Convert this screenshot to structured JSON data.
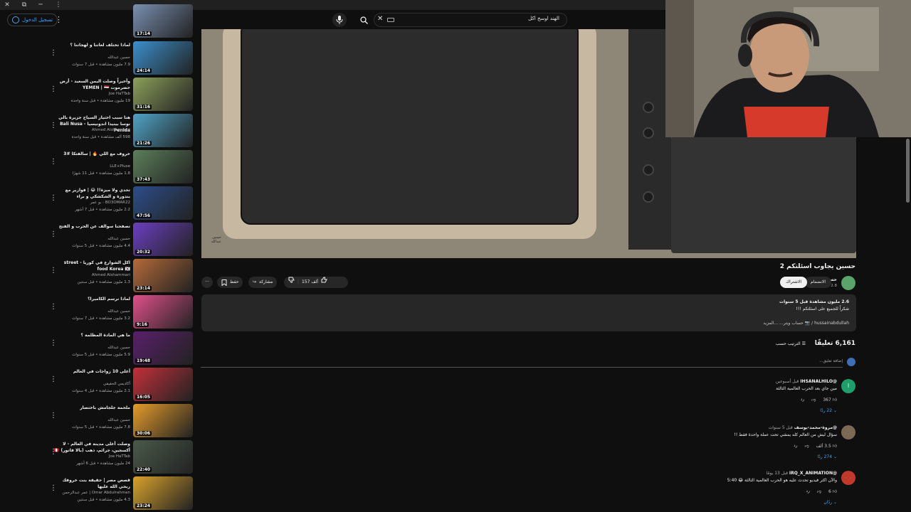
{
  "window": {
    "close": "✕",
    "restore": "⧉",
    "minimize": "─",
    "menu": "⋮"
  },
  "header": {
    "signin_label": "تسجيل الدخول",
    "search_value": "الهند اوسخ اكل"
  },
  "sidebar": {
    "items": [
      {
        "title": "",
        "channel": "",
        "meta": "",
        "duration": "17:14",
        "color": "#7a8fb0"
      },
      {
        "title": "لماذا تختلف لغاتنا و لهجاتنا ؟",
        "channel": "حسين عبدالله",
        "meta": "7.9 مليون مشاهدة • قبل 7 سنوات",
        "duration": "24:14",
        "color": "#3b8fcc"
      },
      {
        "title": "وأخيراً وصلت اليمن السعيد - أرض حضرموت YEMEN | 🇾🇪",
        "channel": "Joe HaTTab",
        "meta": "19 مليون مشاهدة • قبل سنة واحدة",
        "duration": "31:16",
        "color": "#8ca05a"
      },
      {
        "title": "هنا سبب اختيار السياح جزيرة بالي نوسا بينيدا اندونيسيا - Bali Nusa Penida",
        "channel": "Ahmed Alshammari",
        "meta": "598 ألف مشاهدة • قبل سنة واحدة",
        "duration": "21:26",
        "color": "#4fa3c7"
      },
      {
        "title": "خروف مع اللي 🔥 | سالفتكا #3",
        "channel": "LLE+Pluse",
        "meta": "1.8 مليون مشاهدة • قبل 11 شهرًا",
        "duration": "37:43",
        "color": "#5c7f5a"
      },
      {
        "title": "تحدي ولا ميزة!! 😂 | فوازير مع بندورة و الشكشكي و براء",
        "channel": "BO3OMAR22 - بو عمر",
        "meta": "2.2 مليون مشاهدة • قبل 7 أشهر",
        "duration": "47:56",
        "color": "#2d4d8a"
      },
      {
        "title": "تصفحنا سوالف عن الحرب و الفتح",
        "channel": "حسين عبدالله",
        "meta": "4.4 مليون مشاهدة • قبل 5 سنوات",
        "duration": "20:32",
        "color": "#6b3fc2"
      },
      {
        "title": "اكل الشوارع في كوريا - street food Korea 🇰🇷",
        "channel": "Ahmed Alshammari",
        "meta": "1.3 مليون مشاهدة • قبل سنتين",
        "duration": "23:14",
        "color": "#b46a3a"
      },
      {
        "title": "لماذا نرسم الكاميرا؟",
        "channel": "حسين عبدالله",
        "meta": "3.2 مليون مشاهدة • قبل 7 سنوات",
        "duration": "9:16",
        "color": "#e0508a"
      },
      {
        "title": "ما هي المادة المظلمة ؟",
        "channel": "حسين عبدالله",
        "meta": "5.9 مليون مشاهدة • قبل 5 سنوات",
        "duration": "19:48",
        "color": "#5a1f6b"
      },
      {
        "title": "أغلى 10 زواجات في العالم",
        "channel": "أكاديمي الحقيقي",
        "meta": "2.1 مليون مشاهدة • قبل 4 سنوات",
        "duration": "16:05",
        "color": "#c2303a"
      },
      {
        "title": "ملحمة جلجامش باختصار",
        "channel": "حسين عبدالله",
        "meta": "7.8 مليون مشاهدة • قبل 5 سنوات",
        "duration": "30:06",
        "color": "#e59b2a"
      },
      {
        "title": "وصلت أغلى مدينة في العالم - لا أكسجين، جرائم، ذهب (بالا فاتور) 🇵🇪",
        "channel": "Joe HaTTab",
        "meta": "24 مليون مشاهدة • قبل 6 أشهر",
        "duration": "22:40",
        "color": "#4a5a4a"
      },
      {
        "title": "قصص مصر | حقيقة بنت خروفك ربحي الله عليها",
        "channel": "Omar Abdulrahman | عمر عبدالرحمن",
        "meta": "4.3 مليون مشاهدة • قبل سنتين",
        "duration": "23:24",
        "color": "#d9a22c"
      }
    ]
  },
  "video": {
    "title": "حسين يجاوب اسئلتكم 2",
    "channel_name": "حسين عبدالله",
    "subscribers": "2.8 مليون مشترك",
    "join_label": "الانضمام",
    "subscribe_label": "الاشتراك",
    "like_count": "157 ألف",
    "share_label": "مشاركة",
    "save_label": "حفظ",
    "watermark": "حسين عبدالله"
  },
  "description": {
    "stats": "2.6 مليون مشاهدة  قبل 5 سنوات",
    "line1": "شكراً للجميع على اسئلتكم !!!",
    "line2": "hussainabdullah / 📷 حساب ويتر... ...المزيد"
  },
  "comments": {
    "count": "6,161 تعليقًا",
    "sort_label": "الترتيب حسب",
    "add_placeholder": "إضافة تعليق...",
    "items": [
      {
        "author": "@IHSANALHILO",
        "time": "قبل أسبوعين",
        "text": "مين جاي بعد الحرب العالمية الثالثة",
        "likes": "367",
        "reply_label": "رد",
        "replies": "22 ردًا",
        "avatar_color": "#1e9e6a",
        "avatar_letter": "I"
      },
      {
        "author": "@مروة-محمد-يوسف",
        "time": "قبل 5 سنوات",
        "text": "سؤال ليش من العالم كله يمشي تحت عملة واحدة فقط !!",
        "likes": "3.5 ألف",
        "reply_label": "رد",
        "replies": "274 ردًا",
        "avatar_color": "#7a6a55",
        "avatar_letter": ""
      },
      {
        "author": "@IRQ_X_ANIMATION",
        "time": "قبل 13 يومًا",
        "text": "والآن اكثر فيديو تحدث عليه هو الحرب العالمية الثالثة 😂 5:40",
        "likes": "6",
        "reply_label": "رد",
        "replies": "ردّان",
        "avatar_color": "#c0392b",
        "avatar_letter": ""
      }
    ]
  },
  "colors": {
    "accent": "#3ea6ff",
    "background": "#0f0f0f",
    "surface": "#272727"
  }
}
